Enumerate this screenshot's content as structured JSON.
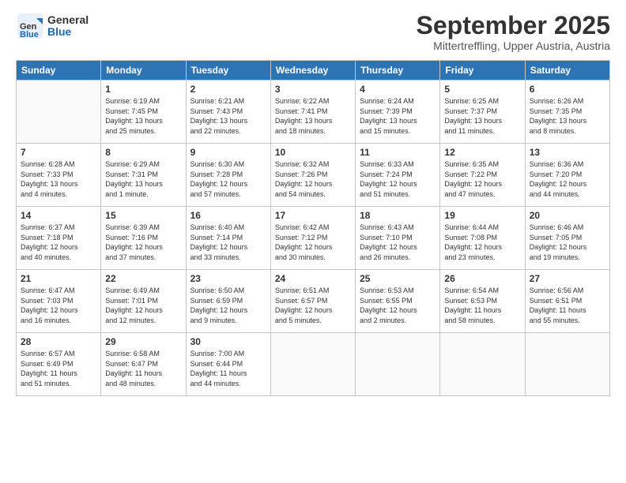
{
  "header": {
    "logo_general": "General",
    "logo_blue": "Blue",
    "month_title": "September 2025",
    "subtitle": "Mittertreffling, Upper Austria, Austria"
  },
  "calendar": {
    "days_of_week": [
      "Sunday",
      "Monday",
      "Tuesday",
      "Wednesday",
      "Thursday",
      "Friday",
      "Saturday"
    ],
    "weeks": [
      [
        {
          "day": "",
          "info": ""
        },
        {
          "day": "1",
          "info": "Sunrise: 6:19 AM\nSunset: 7:45 PM\nDaylight: 13 hours\nand 25 minutes."
        },
        {
          "day": "2",
          "info": "Sunrise: 6:21 AM\nSunset: 7:43 PM\nDaylight: 13 hours\nand 22 minutes."
        },
        {
          "day": "3",
          "info": "Sunrise: 6:22 AM\nSunset: 7:41 PM\nDaylight: 13 hours\nand 18 minutes."
        },
        {
          "day": "4",
          "info": "Sunrise: 6:24 AM\nSunset: 7:39 PM\nDaylight: 13 hours\nand 15 minutes."
        },
        {
          "day": "5",
          "info": "Sunrise: 6:25 AM\nSunset: 7:37 PM\nDaylight: 13 hours\nand 11 minutes."
        },
        {
          "day": "6",
          "info": "Sunrise: 6:26 AM\nSunset: 7:35 PM\nDaylight: 13 hours\nand 8 minutes."
        }
      ],
      [
        {
          "day": "7",
          "info": "Sunrise: 6:28 AM\nSunset: 7:33 PM\nDaylight: 13 hours\nand 4 minutes."
        },
        {
          "day": "8",
          "info": "Sunrise: 6:29 AM\nSunset: 7:31 PM\nDaylight: 13 hours\nand 1 minute."
        },
        {
          "day": "9",
          "info": "Sunrise: 6:30 AM\nSunset: 7:28 PM\nDaylight: 12 hours\nand 57 minutes."
        },
        {
          "day": "10",
          "info": "Sunrise: 6:32 AM\nSunset: 7:26 PM\nDaylight: 12 hours\nand 54 minutes."
        },
        {
          "day": "11",
          "info": "Sunrise: 6:33 AM\nSunset: 7:24 PM\nDaylight: 12 hours\nand 51 minutes."
        },
        {
          "day": "12",
          "info": "Sunrise: 6:35 AM\nSunset: 7:22 PM\nDaylight: 12 hours\nand 47 minutes."
        },
        {
          "day": "13",
          "info": "Sunrise: 6:36 AM\nSunset: 7:20 PM\nDaylight: 12 hours\nand 44 minutes."
        }
      ],
      [
        {
          "day": "14",
          "info": "Sunrise: 6:37 AM\nSunset: 7:18 PM\nDaylight: 12 hours\nand 40 minutes."
        },
        {
          "day": "15",
          "info": "Sunrise: 6:39 AM\nSunset: 7:16 PM\nDaylight: 12 hours\nand 37 minutes."
        },
        {
          "day": "16",
          "info": "Sunrise: 6:40 AM\nSunset: 7:14 PM\nDaylight: 12 hours\nand 33 minutes."
        },
        {
          "day": "17",
          "info": "Sunrise: 6:42 AM\nSunset: 7:12 PM\nDaylight: 12 hours\nand 30 minutes."
        },
        {
          "day": "18",
          "info": "Sunrise: 6:43 AM\nSunset: 7:10 PM\nDaylight: 12 hours\nand 26 minutes."
        },
        {
          "day": "19",
          "info": "Sunrise: 6:44 AM\nSunset: 7:08 PM\nDaylight: 12 hours\nand 23 minutes."
        },
        {
          "day": "20",
          "info": "Sunrise: 6:46 AM\nSunset: 7:05 PM\nDaylight: 12 hours\nand 19 minutes."
        }
      ],
      [
        {
          "day": "21",
          "info": "Sunrise: 6:47 AM\nSunset: 7:03 PM\nDaylight: 12 hours\nand 16 minutes."
        },
        {
          "day": "22",
          "info": "Sunrise: 6:49 AM\nSunset: 7:01 PM\nDaylight: 12 hours\nand 12 minutes."
        },
        {
          "day": "23",
          "info": "Sunrise: 6:50 AM\nSunset: 6:59 PM\nDaylight: 12 hours\nand 9 minutes."
        },
        {
          "day": "24",
          "info": "Sunrise: 6:51 AM\nSunset: 6:57 PM\nDaylight: 12 hours\nand 5 minutes."
        },
        {
          "day": "25",
          "info": "Sunrise: 6:53 AM\nSunset: 6:55 PM\nDaylight: 12 hours\nand 2 minutes."
        },
        {
          "day": "26",
          "info": "Sunrise: 6:54 AM\nSunset: 6:53 PM\nDaylight: 11 hours\nand 58 minutes."
        },
        {
          "day": "27",
          "info": "Sunrise: 6:56 AM\nSunset: 6:51 PM\nDaylight: 11 hours\nand 55 minutes."
        }
      ],
      [
        {
          "day": "28",
          "info": "Sunrise: 6:57 AM\nSunset: 6:49 PM\nDaylight: 11 hours\nand 51 minutes."
        },
        {
          "day": "29",
          "info": "Sunrise: 6:58 AM\nSunset: 6:47 PM\nDaylight: 11 hours\nand 48 minutes."
        },
        {
          "day": "30",
          "info": "Sunrise: 7:00 AM\nSunset: 6:44 PM\nDaylight: 11 hours\nand 44 minutes."
        },
        {
          "day": "",
          "info": ""
        },
        {
          "day": "",
          "info": ""
        },
        {
          "day": "",
          "info": ""
        },
        {
          "day": "",
          "info": ""
        }
      ]
    ]
  }
}
